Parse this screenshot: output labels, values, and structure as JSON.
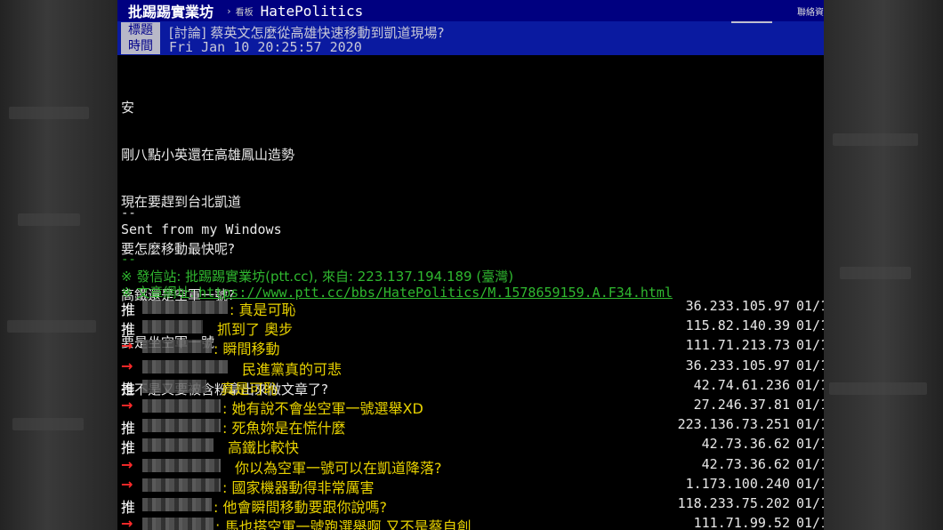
{
  "nav": {
    "site": "批踢踢實業坊",
    "chevron": "›",
    "board_label": "看板",
    "board": "HatePolitics",
    "contact": "聯絡資"
  },
  "header": {
    "title_label": "標題",
    "title": "[討論] 蔡英文怎麼從高雄快速移動到凱道現場?",
    "time_label": "時間",
    "time": "Fri Jan 10 20:25:57 2020"
  },
  "body": {
    "lines": [
      "安",
      "剛八點小英還在高雄鳳山造勢",
      "現在要趕到台北凱道",
      "要怎麼移動最快呢?",
      "高鐵還是空軍一號?",
      "要是坐空軍一號",
      "是不是又要被含粉拿出來做文章了?"
    ],
    "separator": "--",
    "signature": "Sent from my Windows",
    "separator2": "--"
  },
  "meta": {
    "origin": "※ 發信站: 批踢踢實業坊(ptt.cc), 來自: 223.137.194.189 (臺灣)",
    "url_label": "※ 文章網址: ",
    "url": "https://www.ptt.cc/bbs/HatePolitics/M.1578659159.A.F34.html"
  },
  "comments": [
    {
      "tag": "推",
      "type": "push",
      "text": ": 真是可恥",
      "ip": "36.233.105.97",
      "date": "01/1"
    },
    {
      "tag": "推",
      "type": "push",
      "text": "抓到了 奧步",
      "ip": "115.82.140.39",
      "date": "01/1"
    },
    {
      "tag": "→",
      "type": "arrow",
      "text": ": 瞬間移動",
      "ip": "111.71.213.73",
      "date": "01/1"
    },
    {
      "tag": "→",
      "type": "arrow",
      "text": "民進黨真的可悲",
      "ip": "36.233.105.97",
      "date": "01/1"
    },
    {
      "tag": "推",
      "type": "push",
      "text": "真是可恥",
      "ip": "42.74.61.236",
      "date": "01/1"
    },
    {
      "tag": "→",
      "type": "arrow",
      "text": ": 她有說不會坐空軍一號選舉XD",
      "ip": "27.246.37.81",
      "date": "01/1"
    },
    {
      "tag": "推",
      "type": "push",
      "text": ": 死魚妳是在慌什麼",
      "ip": "223.136.73.251",
      "date": "01/1"
    },
    {
      "tag": "推",
      "type": "push",
      "text": "高鐵比較快",
      "ip": "42.73.36.62",
      "date": "01/1"
    },
    {
      "tag": "→",
      "type": "arrow",
      "text": "你以為空軍一號可以在凱道降落?",
      "ip": "42.73.36.62",
      "date": "01/1"
    },
    {
      "tag": "→",
      "type": "arrow",
      "text": ": 國家機器動得非常厲害",
      "ip": "1.173.100.240",
      "date": "01/1"
    },
    {
      "tag": "推",
      "type": "push",
      "text": ": 他會瞬間移動要跟你說嗎?",
      "ip": "118.233.75.202",
      "date": "01/1"
    },
    {
      "tag": "→",
      "type": "arrow",
      "text": ": 馬也搭空軍一號跑選舉啊 又不是蔡自創.",
      "ip": "111.71.99.52",
      "date": "01/1"
    }
  ],
  "colors": {
    "nav_bg": "#000080",
    "header_bg": "#0a1aa0",
    "push_text": "#e8d200",
    "meta_green": "#2fb82f",
    "arrow_red": "#ff2a2a"
  }
}
